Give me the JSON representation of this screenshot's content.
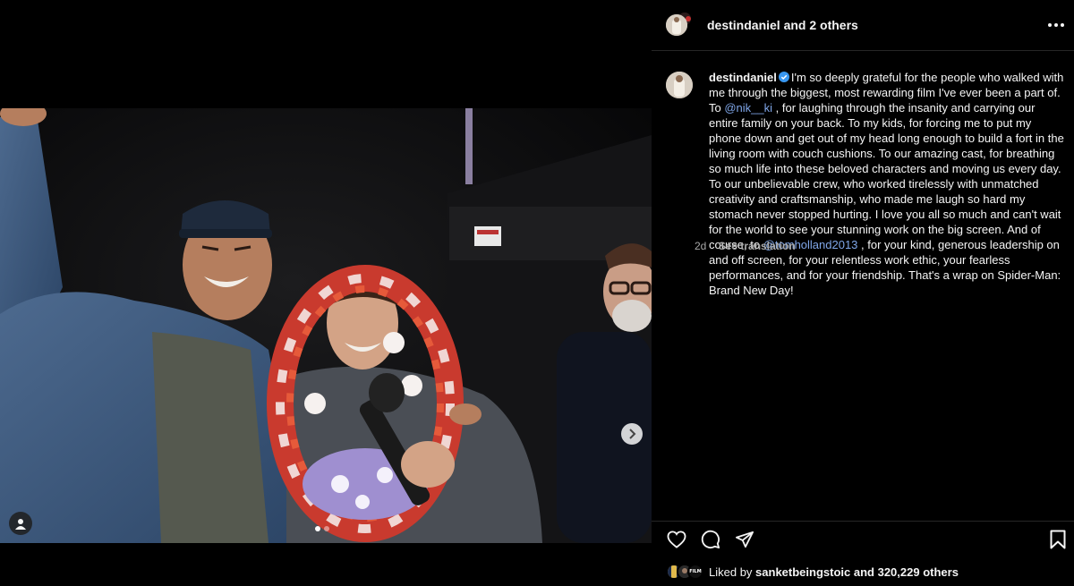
{
  "header": {
    "username": "destindaniel",
    "others_text": "and 2 others"
  },
  "caption": {
    "username": "destindaniel",
    "part1": "I'm so deeply grateful for the people who walked with me through the biggest, most rewarding film I've ever been a part of. To ",
    "mention1": "@nik__ki",
    "part2": " , for laughing through the insanity and carrying our entire family on your back. To my kids, for forcing me to put my phone down and get out of my head long enough to build a fort in the living room with couch cushions. To our amazing cast, for breathing so much life into these beloved characters and moving us every day. To our unbelievable crew, who worked tirelessly with unmatched creativity and craftsmanship, who made me laugh so hard my stomach never stopped hurting. I love you all so much and can't wait for the world to see your stunning work on the big screen. And of course, to ",
    "mention2": "@tomholland2013",
    "part3": " , for your kind, generous leadership on and off screen, for your relentless work ethic, your fearless performances, and for your friendship. That's a wrap on Spider-Man: Brand New Day!",
    "time": "2d",
    "see_translation": "See translation"
  },
  "likes": {
    "prefix": "Liked by",
    "user": "sanketbeingstoic",
    "suffix": "and 320,229 others",
    "mini_label": "FILM"
  },
  "media": {
    "slide_current": 1,
    "slide_total": 2
  },
  "colors": {
    "mention": "#7fa6e8",
    "verified": "#3897f0",
    "panel_bg": "#000000"
  },
  "icons": [
    "more-icon",
    "verified-icon",
    "heart-icon",
    "comment-icon",
    "share-icon",
    "bookmark-icon",
    "chevron-right-icon",
    "user-tag-icon"
  ]
}
